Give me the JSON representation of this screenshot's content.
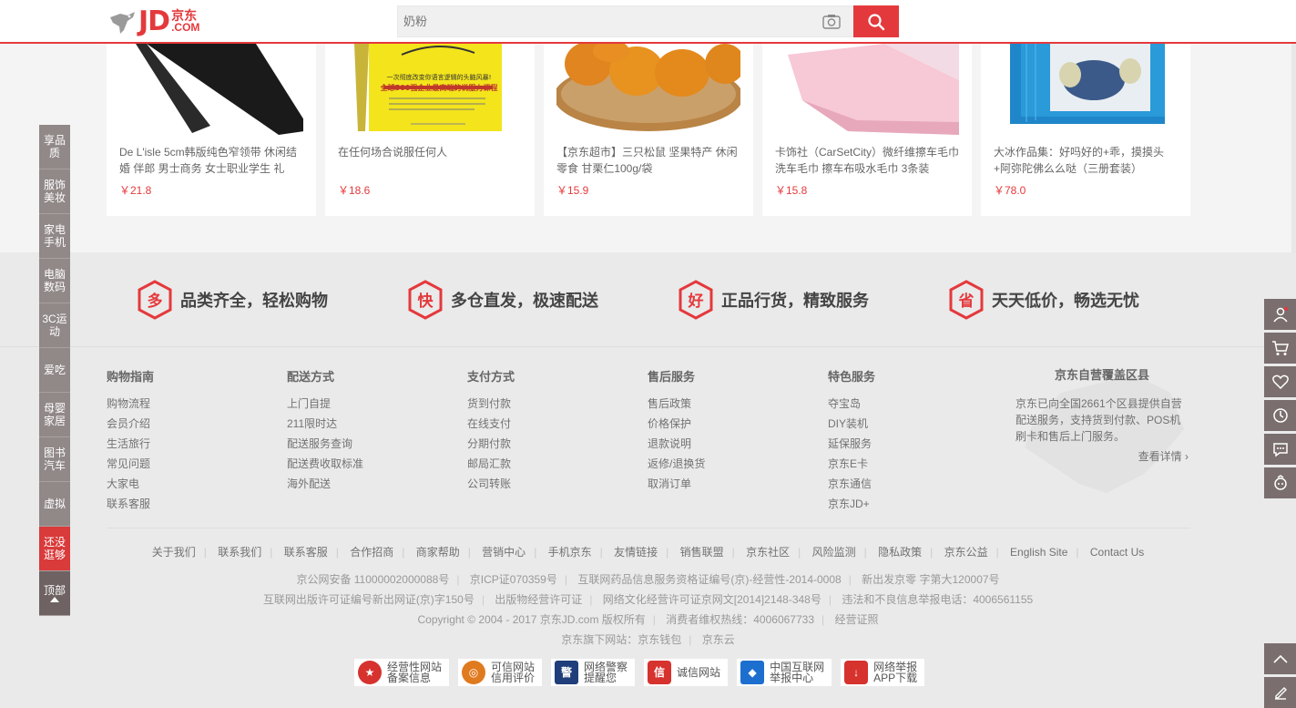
{
  "header": {
    "logo_text": "JD",
    "logo_cn": "京东",
    "logo_com": ".COM",
    "search_placeholder": "奶粉"
  },
  "products": [
    {
      "title": "De L'isle 5cm韩版纯色窄领带 休闲结婚 伴郎 男士商务 女士职业学生 礼",
      "price": "￥21.8"
    },
    {
      "title": "在任何场合说服任何人",
      "price": "￥18.6"
    },
    {
      "title": "【京东超市】三只松鼠 坚果特产 休闲零食 甘栗仁100g/袋",
      "price": "￥15.9"
    },
    {
      "title": "卡饰社（CarSetCity）微纤维擦车毛巾洗车毛巾 擦车布吸水毛巾 3条装",
      "price": "￥15.8"
    },
    {
      "title": "大冰作品集：好吗好的+乖，摸摸头+阿弥陀佛么么哒（三册套装）",
      "price": "￥78.0"
    }
  ],
  "book_cover": {
    "line1": "一次彻底改变你语言逻辑的头脑风暴!",
    "line2": "全球500强企业最高端的说服力课程"
  },
  "promises": [
    {
      "glyph": "多",
      "text": "品类齐全，轻松购物"
    },
    {
      "glyph": "快",
      "text": "多仓直发，极速配送"
    },
    {
      "glyph": "好",
      "text": "正品行货，精致服务"
    },
    {
      "glyph": "省",
      "text": "天天低价，畅选无忧"
    }
  ],
  "footer_columns": [
    {
      "title": "购物指南",
      "items": [
        "购物流程",
        "会员介绍",
        "生活旅行",
        "常见问题",
        "大家电",
        "联系客服"
      ]
    },
    {
      "title": "配送方式",
      "items": [
        "上门自提",
        "211限时达",
        "配送服务查询",
        "配送费收取标准",
        "海外配送"
      ]
    },
    {
      "title": "支付方式",
      "items": [
        "货到付款",
        "在线支付",
        "分期付款",
        "邮局汇款",
        "公司转账"
      ]
    },
    {
      "title": "售后服务",
      "items": [
        "售后政策",
        "价格保护",
        "退款说明",
        "返修/退换货",
        "取消订单"
      ]
    },
    {
      "title": "特色服务",
      "items": [
        "夺宝岛",
        "DIY装机",
        "延保服务",
        "京东E卡",
        "京东通信",
        "京东JD+"
      ]
    }
  ],
  "coverage": {
    "title": "京东自营覆盖区县",
    "text": "京东已向全国2661个区县提供自营配送服务，支持货到付款、POS机刷卡和售后上门服务。",
    "more": "查看详情 ›"
  },
  "bottom_links": [
    "关于我们",
    "联系我们",
    "联系客服",
    "合作招商",
    "商家帮助",
    "营销中心",
    "手机京东",
    "友情链接",
    "销售联盟",
    "京东社区",
    "风险监测",
    "隐私政策",
    "京东公益",
    "English Site",
    "Contact Us"
  ],
  "copyright_lines": [
    [
      "京公网安备 11000002000088号",
      "京ICP证070359号",
      "互联网药品信息服务资格证编号(京)-经营性-2014-0008",
      "新出发京零 字第大120007号"
    ],
    [
      "互联网出版许可证编号新出网证(京)字150号",
      "出版物经营许可证",
      "网络文化经营许可证京网文[2014]2148-348号",
      "违法和不良信息举报电话：4006561155"
    ],
    [
      "Copyright © 2004 - 2017  京东JD.com 版权所有",
      "消费者维权热线：4006067733",
      "经营证照"
    ],
    [
      "京东旗下网站：京东钱包",
      "京东云"
    ]
  ],
  "badges": [
    {
      "l1": "经营性网站",
      "l2": "备案信息",
      "color": "#d6322e",
      "glyph": "★"
    },
    {
      "l1": "可信网站",
      "l2": "信用评价",
      "color": "#e07a1f",
      "glyph": "◎"
    },
    {
      "l1": "网络警察",
      "l2": "提醒您",
      "color": "#1f3e7a",
      "glyph": "警"
    },
    {
      "l1": "诚信网站",
      "l2": "",
      "color": "#d6322e",
      "glyph": "信"
    },
    {
      "l1": "中国互联网",
      "l2": "举报中心",
      "color": "#1d6fcf",
      "glyph": "◆"
    },
    {
      "l1": "网络举报",
      "l2": "APP下载",
      "color": "#d6322e",
      "glyph": "↓"
    }
  ],
  "left_nav": [
    "享品质",
    "服饰美妆",
    "家电手机",
    "电脑数码",
    "3C运动",
    "爱吃",
    "母婴家居",
    "图书汽车",
    "虚拟",
    "还没逛够",
    "顶部"
  ],
  "right_toolbar_icons": [
    "user-icon",
    "cart-icon",
    "heart-icon",
    "history-icon",
    "message-icon",
    "feedback-icon"
  ],
  "right_bottom_icons": [
    "top-arrow-icon",
    "edit-icon"
  ],
  "colors": {
    "accent": "#e4393c",
    "nav": "#918888"
  }
}
